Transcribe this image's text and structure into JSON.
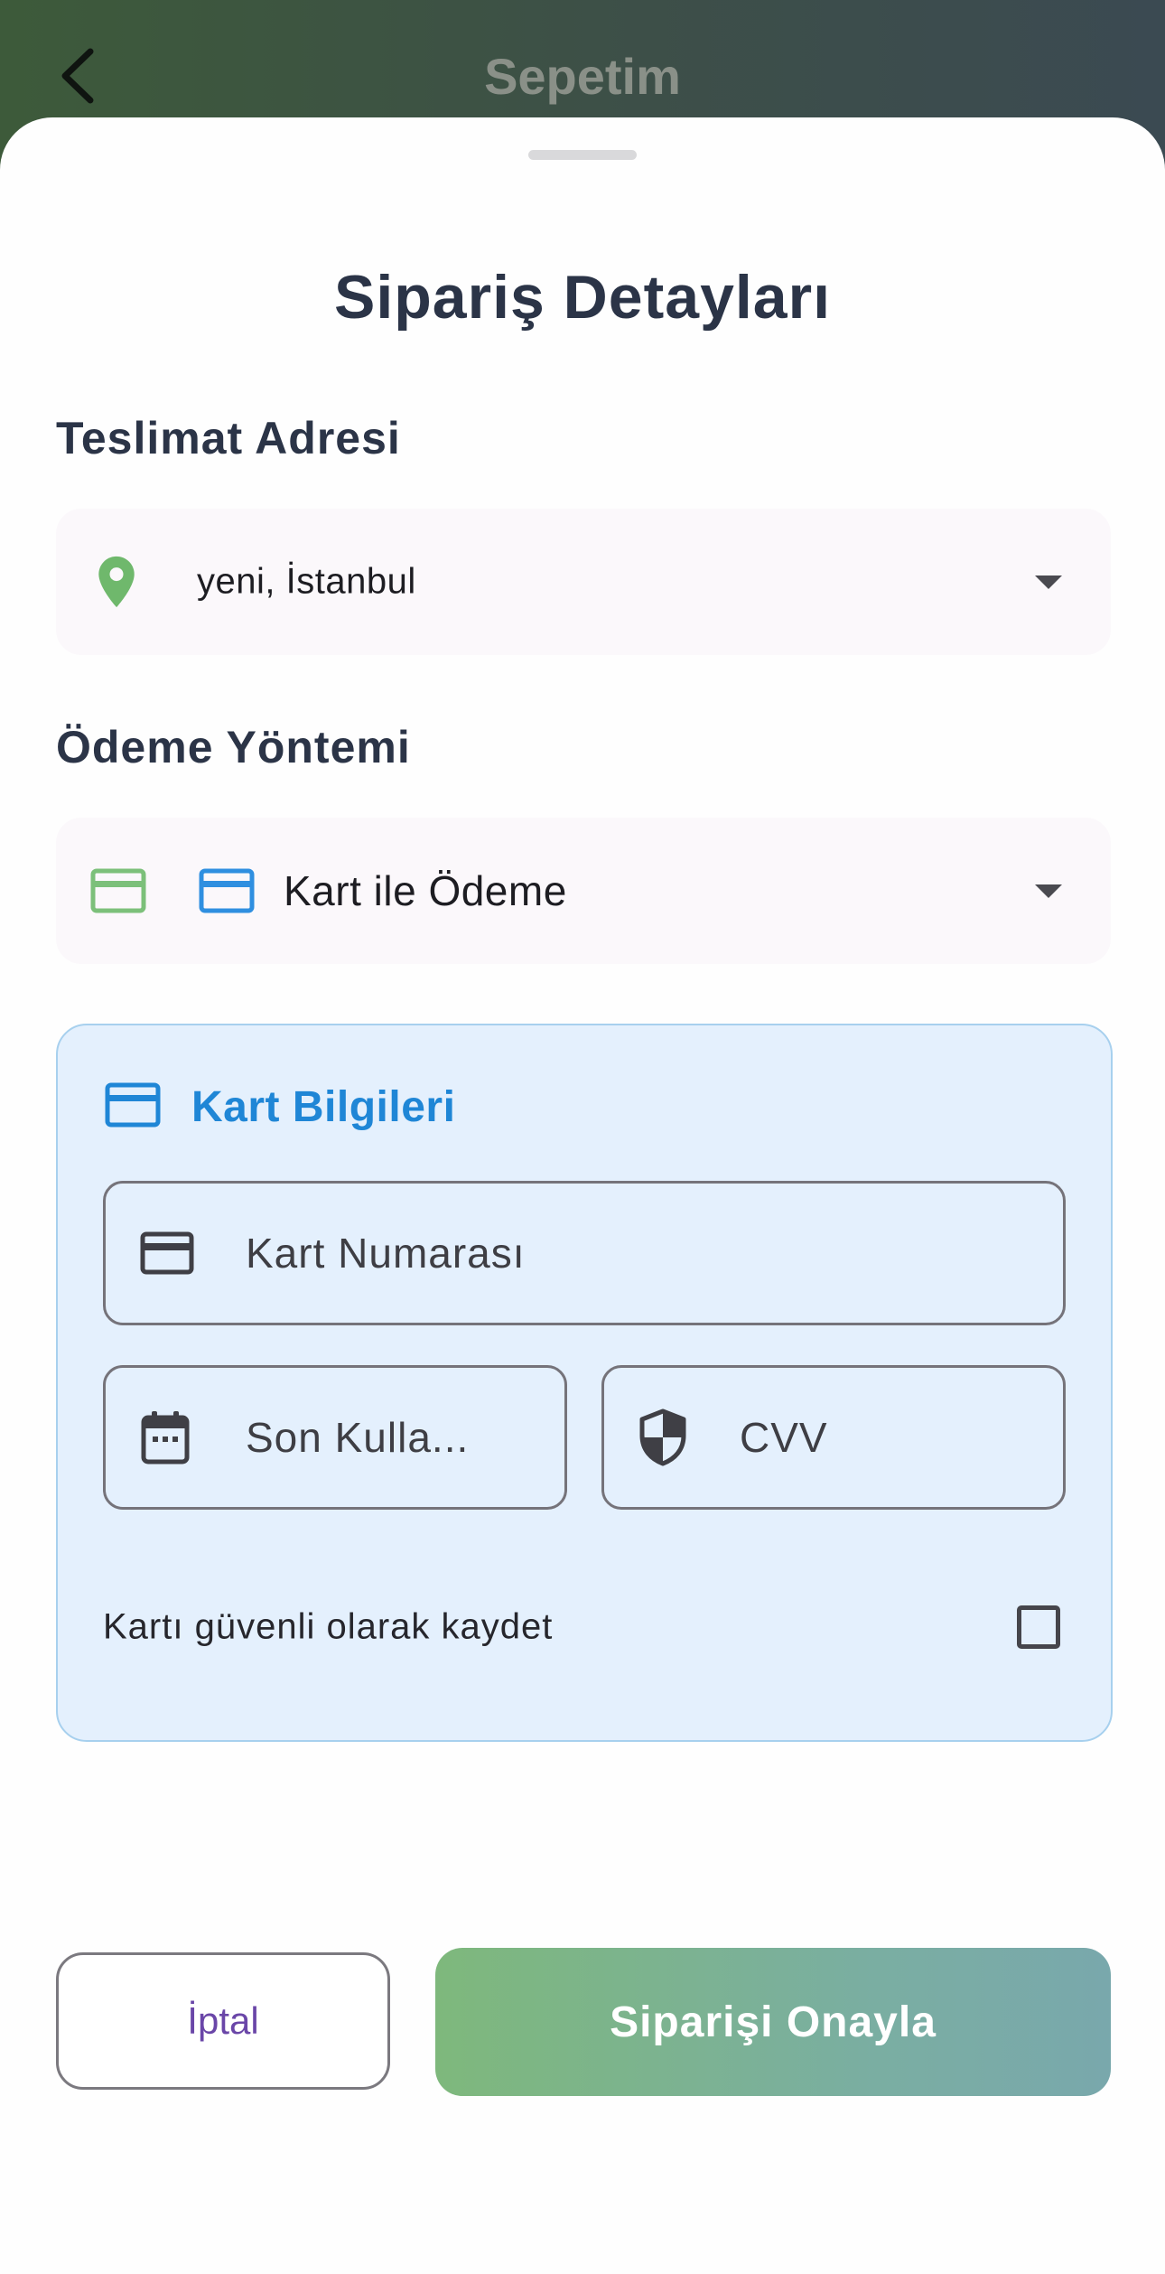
{
  "app_bar": {
    "title": "Sepetim",
    "back_icon": "chevron-left-icon"
  },
  "sheet": {
    "title": "Sipariş Detayları"
  },
  "delivery": {
    "label": "Teslimat Adresi",
    "selected": "yeni, İstanbul",
    "icon": "location-pin-icon",
    "icon_color": "#6fb86c"
  },
  "payment": {
    "label": "Ödeme Yöntemi",
    "selected": "Kart ile Ödeme",
    "leading_icon": "credit-card-icon",
    "leading_icon_color": "#7cc07a",
    "item_icon": "credit-card-icon",
    "item_icon_color": "#2f8fe0"
  },
  "card_info": {
    "title": "Kart Bilgileri",
    "icon": "credit-card-icon",
    "accent": "#1f86d6",
    "card_number_placeholder": "Kart Numarası",
    "expiry_placeholder": "Son Kulla...",
    "cvv_placeholder": "CVV",
    "save_card_label": "Kartı güvenli olarak kaydet",
    "save_card_checked": false
  },
  "actions": {
    "cancel_label": "İptal",
    "confirm_label": "Siparişi Onayla"
  }
}
